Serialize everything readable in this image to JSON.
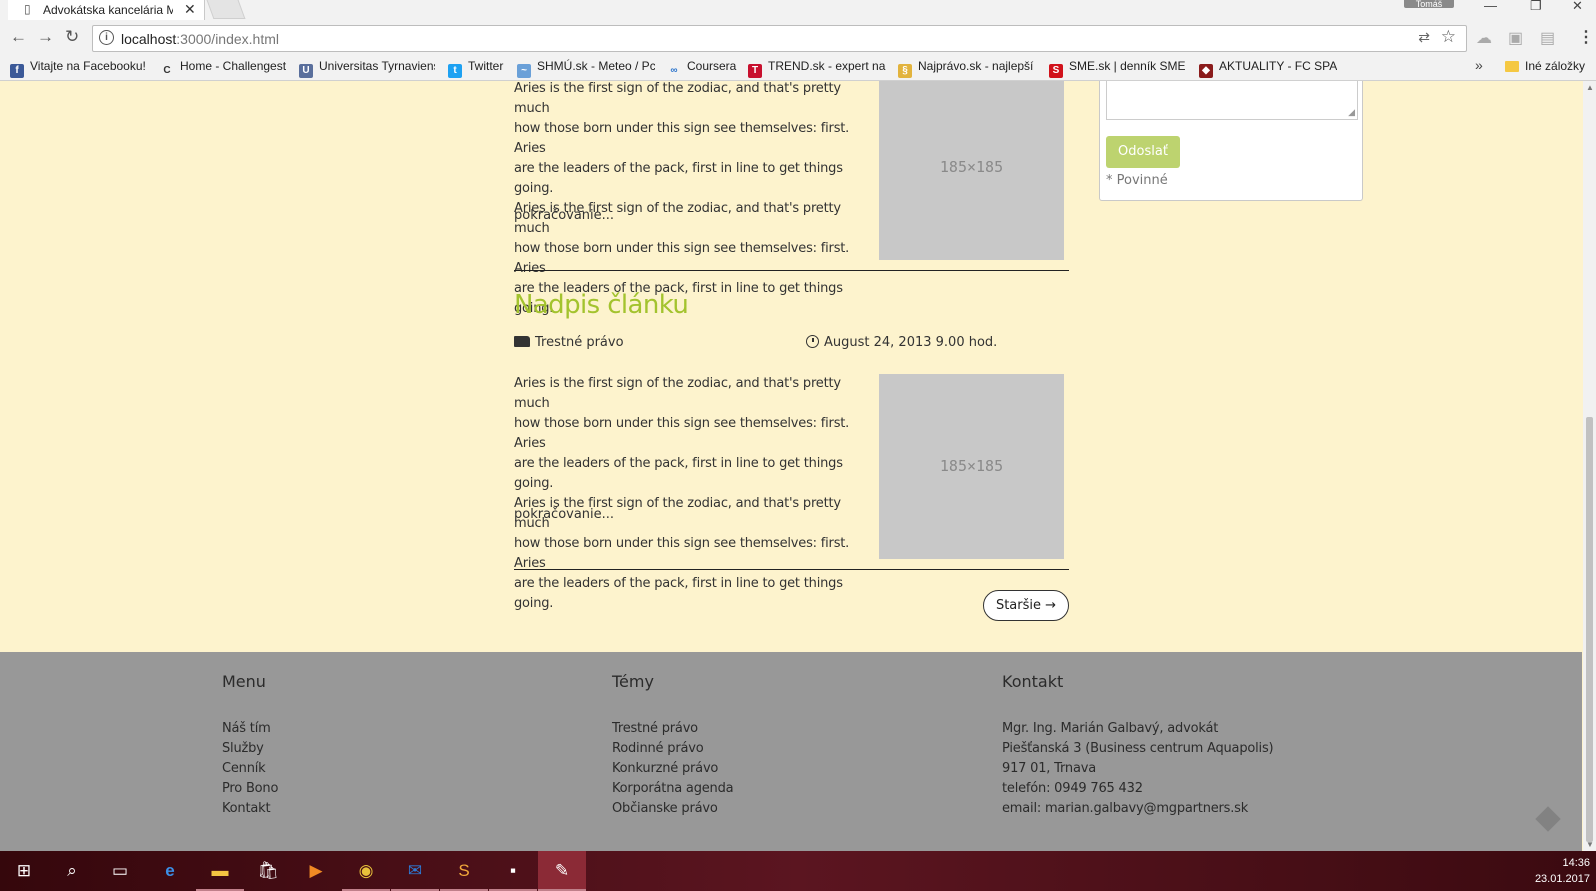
{
  "browser": {
    "tab_title": "Advokátska kancelária M",
    "user": "Tomáš",
    "url_host": "localhost",
    "url_path": ":3000/index.html",
    "bookmarks": [
      {
        "label": "Vitajte na Facebooku!",
        "color": "#3b5998",
        "glyph": "f"
      },
      {
        "label": "Home - Challengest",
        "color": "#f2f2f2",
        "glyph": "C"
      },
      {
        "label": "Universitas Tyrnaviens",
        "color": "#5a6f9c",
        "glyph": "U"
      },
      {
        "label": "Twitter",
        "color": "#1da1f2",
        "glyph": "t"
      },
      {
        "label": "SHMÚ.sk - Meteo / Pc",
        "color": "#6aa0d8",
        "glyph": "~"
      },
      {
        "label": "Coursera",
        "color": "#f2f2f2",
        "glyph": "∞"
      },
      {
        "label": "TREND.sk - expert na",
        "color": "#c8102e",
        "glyph": "T"
      },
      {
        "label": "Najprávo.sk - najlepší",
        "color": "#e2b33d",
        "glyph": "§"
      },
      {
        "label": "SME.sk | denník SME -",
        "color": "#d1121b",
        "glyph": "S"
      },
      {
        "label": "AKTUALITY - FC SPAR",
        "color": "#8b1c1c",
        "glyph": "◆"
      }
    ],
    "bookmarks_more": "»",
    "other_bookmarks": "Iné záložky"
  },
  "articles": [
    {
      "title": "",
      "excerpt_lines": [
        "Aries is the first sign of the zodiac, and that's pretty much",
        "how those born under this sign see themselves: first. Aries",
        "are the leaders of the pack, first in line to get things going.",
        "Aries is the first sign of the zodiac, and that's pretty much",
        "how those born under this sign see themselves: first. Aries",
        "are the leaders of the pack, first in line to get things going."
      ],
      "more": "pokračovanie...",
      "image_label": "185×185"
    },
    {
      "title": "Nadpis článku",
      "category": "Trestné právo",
      "date": "August 24, 2013 9.00 hod.",
      "excerpt_lines": [
        "Aries is the first sign of the zodiac, and that's pretty much",
        "how those born under this sign see themselves: first. Aries",
        "are the leaders of the pack, first in line to get things going.",
        "Aries is the first sign of the zodiac, and that's pretty much",
        "how those born under this sign see themselves: first. Aries",
        "are the leaders of the pack, first in line to get things going."
      ],
      "more": "pokračovanie...",
      "image_label": "185×185"
    }
  ],
  "pagination": {
    "older": "Staršie →"
  },
  "sidebar": {
    "submit": "Odoslať",
    "required_note": "* Povinné"
  },
  "footer": {
    "menu": {
      "heading": "Menu",
      "items": [
        "Náš tím",
        "Služby",
        "Cenník",
        "Pro Bono",
        "Kontakt"
      ]
    },
    "topics": {
      "heading": "Témy",
      "items": [
        "Trestné právo",
        "Rodinné právo",
        "Konkurzné právo",
        "Korporátna agenda",
        "Občianske právo"
      ]
    },
    "contact": {
      "heading": "Kontakt",
      "items": [
        "Mgr. Ing. Marián Galbavý, advokát",
        "Piešťanská 3 (Business centrum Aquapolis)",
        "917 01, Trnava",
        "telefón: 0949 765 432",
        "email: marian.galbavy@mgpartners.sk"
      ]
    }
  },
  "taskbar": {
    "time": "14:36",
    "date": "23.01.2017"
  },
  "colors": {
    "page_bg": "#fdf3cd",
    "accent_green": "#a3c32e",
    "footer_bg": "#989898",
    "taskbar": "#4a0e16"
  }
}
